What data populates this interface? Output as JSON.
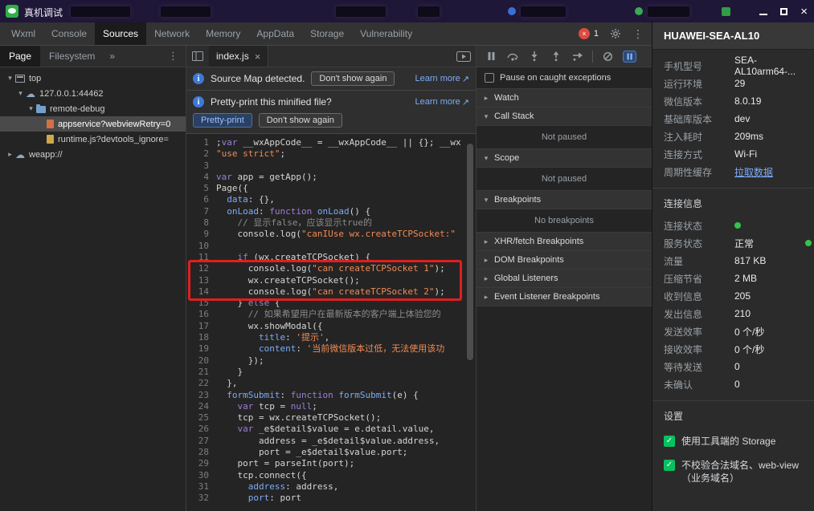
{
  "icons": {
    "close_x": "×",
    "error_x": "×",
    "kebab": "⋮",
    "overflow": "»",
    "external": "↗",
    "cloud": "☁",
    "check": "✓",
    "expanded": "▾",
    "collapsed": "▸",
    "info": "i"
  },
  "titlebar": {
    "title": "真机调试"
  },
  "devtools": {
    "tabs": [
      {
        "label": "Wxml",
        "active": false
      },
      {
        "label": "Console",
        "active": false
      },
      {
        "label": "Sources",
        "active": true
      },
      {
        "label": "Network",
        "active": false
      },
      {
        "label": "Memory",
        "active": false
      },
      {
        "label": "AppData",
        "active": false
      },
      {
        "label": "Storage",
        "active": false
      },
      {
        "label": "Vulnerability",
        "active": false
      }
    ],
    "error_count": "1"
  },
  "sources": {
    "sidebar": {
      "tabs": [
        {
          "label": "Page",
          "active": true
        },
        {
          "label": "Filesystem",
          "active": false
        }
      ],
      "tree": [
        {
          "depth": 0,
          "arrow": "expanded",
          "icon": "frame",
          "label": "top"
        },
        {
          "depth": 1,
          "arrow": "expanded",
          "icon": "cloud",
          "label": "127.0.0.1:44462"
        },
        {
          "depth": 2,
          "arrow": "expanded",
          "icon": "folder",
          "label": "remote-debug"
        },
        {
          "depth": 3,
          "arrow": "none",
          "icon": "file-orange",
          "label": "appservice?webviewRetry=0",
          "selected": true
        },
        {
          "depth": 3,
          "arrow": "none",
          "icon": "file-js",
          "label": "runtime.js?devtools_ignore="
        },
        {
          "depth": 0,
          "arrow": "collapsed",
          "icon": "cloud",
          "label": "weapp://"
        }
      ]
    },
    "editor": {
      "tab": "index.js",
      "infobars": [
        {
          "message": "Source Map detected.",
          "dismiss": "Don't show again",
          "link": "Learn more"
        },
        {
          "message": "Pretty-print this minified file?",
          "primary": "Pretty-print",
          "dismiss": "Don't show again",
          "link": "Learn more"
        }
      ],
      "code": {
        "lines": [
          {
            "n": 1,
            "s": [
              [
                "d",
                ";"
              ],
              [
                "k",
                "var"
              ],
              [
                "d",
                " __wxAppCode__ = __wxAppCode__ || {}; __wx"
              ]
            ]
          },
          {
            "n": 2,
            "s": [
              [
                "s",
                "\"use strict\""
              ],
              [
                "d",
                ";"
              ]
            ]
          },
          {
            "n": 3,
            "s": []
          },
          {
            "n": 4,
            "s": [
              [
                "k",
                "var"
              ],
              [
                "d",
                " app = getApp();"
              ]
            ]
          },
          {
            "n": 5,
            "s": [
              [
                "d",
                "Page({"
              ]
            ]
          },
          {
            "n": 6,
            "s": [
              [
                "d",
                "  "
              ],
              [
                "p",
                "data"
              ],
              [
                "d",
                ": {},"
              ]
            ]
          },
          {
            "n": 7,
            "s": [
              [
                "d",
                "  "
              ],
              [
                "p",
                "onLoad"
              ],
              [
                "d",
                ": "
              ],
              [
                "k",
                "function"
              ],
              [
                "d",
                " "
              ],
              [
                "p",
                "onLoad"
              ],
              [
                "d",
                "() {"
              ]
            ]
          },
          {
            "n": 8,
            "s": [
              [
                "d",
                "    "
              ],
              [
                "c",
                "// 显示false，应该显示true的"
              ]
            ]
          },
          {
            "n": 9,
            "s": [
              [
                "d",
                "    console.log("
              ],
              [
                "s",
                "\"canIUse wx.createTCPSocket:\""
              ]
            ]
          },
          {
            "n": 10,
            "s": []
          },
          {
            "n": 11,
            "s": [
              [
                "d",
                "    "
              ],
              [
                "k",
                "if"
              ],
              [
                "d",
                " (wx.createTCPSocket) {"
              ]
            ]
          },
          {
            "n": 12,
            "s": [
              [
                "d",
                "      console.log("
              ],
              [
                "s",
                "\"can createTCPSocket 1\""
              ],
              [
                "d",
                ");"
              ]
            ]
          },
          {
            "n": 13,
            "s": [
              [
                "d",
                "      wx.createTCPSocket();"
              ]
            ]
          },
          {
            "n": 14,
            "s": [
              [
                "d",
                "      console.log("
              ],
              [
                "s",
                "\"can createTCPSocket 2\""
              ],
              [
                "d",
                ");"
              ]
            ]
          },
          {
            "n": 15,
            "s": [
              [
                "d",
                "    } "
              ],
              [
                "k",
                "else"
              ],
              [
                "d",
                " {"
              ]
            ]
          },
          {
            "n": 16,
            "s": [
              [
                "d",
                "      "
              ],
              [
                "c",
                "// 如果希望用户在最新版本的客户端上体验您的"
              ]
            ]
          },
          {
            "n": 17,
            "s": [
              [
                "d",
                "      wx.showModal({"
              ]
            ]
          },
          {
            "n": 18,
            "s": [
              [
                "d",
                "        "
              ],
              [
                "p",
                "title"
              ],
              [
                "d",
                ": "
              ],
              [
                "s",
                "'提示'"
              ],
              [
                "d",
                ","
              ]
            ]
          },
          {
            "n": 19,
            "s": [
              [
                "d",
                "        "
              ],
              [
                "p",
                "content"
              ],
              [
                "d",
                ": "
              ],
              [
                "s",
                "'当前微信版本过低，无法使用该功"
              ]
            ]
          },
          {
            "n": 20,
            "s": [
              [
                "d",
                "      });"
              ]
            ]
          },
          {
            "n": 21,
            "s": [
              [
                "d",
                "    }"
              ]
            ]
          },
          {
            "n": 22,
            "s": [
              [
                "d",
                "  },"
              ]
            ]
          },
          {
            "n": 23,
            "s": [
              [
                "d",
                "  "
              ],
              [
                "p",
                "formSubmit"
              ],
              [
                "d",
                ": "
              ],
              [
                "k",
                "function"
              ],
              [
                "d",
                " "
              ],
              [
                "p",
                "formSubmit"
              ],
              [
                "d",
                "(e) {"
              ]
            ]
          },
          {
            "n": 24,
            "s": [
              [
                "d",
                "    "
              ],
              [
                "k",
                "var"
              ],
              [
                "d",
                " tcp = "
              ],
              [
                "k",
                "null"
              ],
              [
                "d",
                ";"
              ]
            ]
          },
          {
            "n": 25,
            "s": [
              [
                "d",
                "    tcp = wx.createTCPSocket();"
              ]
            ]
          },
          {
            "n": 26,
            "s": [
              [
                "d",
                "    "
              ],
              [
                "k",
                "var"
              ],
              [
                "d",
                " _e$detail$value = e.detail.value,"
              ]
            ]
          },
          {
            "n": 27,
            "s": [
              [
                "d",
                "        address = _e$detail$value.address,"
              ]
            ]
          },
          {
            "n": 28,
            "s": [
              [
                "d",
                "        port = _e$detail$value.port;"
              ]
            ]
          },
          {
            "n": 29,
            "s": [
              [
                "d",
                "    port = parseInt(port);"
              ]
            ]
          },
          {
            "n": 30,
            "s": [
              [
                "d",
                "    tcp.connect({"
              ]
            ]
          },
          {
            "n": 31,
            "s": [
              [
                "d",
                "      "
              ],
              [
                "p",
                "address"
              ],
              [
                "d",
                ": address,"
              ]
            ]
          },
          {
            "n": 32,
            "s": [
              [
                "d",
                "      "
              ],
              [
                "p",
                "port"
              ],
              [
                "d",
                ": port"
              ]
            ]
          }
        ]
      }
    }
  },
  "debugger": {
    "toolbar_icons": [
      "pause",
      "step-over",
      "step-into",
      "step-out",
      "step",
      "deactivate-breakpoints",
      "pause-on-exceptions"
    ],
    "pause_on_caught": {
      "label": "Pause on caught exceptions",
      "checked": false
    },
    "sections": [
      {
        "label": "Watch",
        "state": "collapsed"
      },
      {
        "label": "Call Stack",
        "state": "expanded",
        "body": "Not paused"
      },
      {
        "label": "Scope",
        "state": "expanded",
        "body": "Not paused"
      },
      {
        "label": "Breakpoints",
        "state": "expanded",
        "body": "No breakpoints"
      },
      {
        "label": "XHR/fetch Breakpoints",
        "state": "collapsed"
      },
      {
        "label": "DOM Breakpoints",
        "state": "collapsed"
      },
      {
        "label": "Global Listeners",
        "state": "collapsed"
      },
      {
        "label": "Event Listener Breakpoints",
        "state": "collapsed"
      }
    ]
  },
  "device_panel": {
    "title": "HUAWEI-SEA-AL10",
    "info_rows": [
      {
        "label": "手机型号",
        "value": "SEA-AL10arm64-..."
      },
      {
        "label": "运行环境",
        "value": "29"
      },
      {
        "label": "微信版本",
        "value": "8.0.19"
      },
      {
        "label": "基础库版本",
        "value": "dev"
      },
      {
        "label": "注入耗时",
        "value": "209ms"
      },
      {
        "label": "连接方式",
        "value": "Wi-Fi"
      },
      {
        "label": "周期性缓存",
        "value": "拉取数据",
        "link": true
      }
    ],
    "connection_section": {
      "title": "连接信息",
      "rows": [
        {
          "label": "连接状态",
          "value": "",
          "dot": true
        },
        {
          "label": "服务状态",
          "value": "正常",
          "edge_dot": true
        },
        {
          "label": "流量",
          "value": "817 KB"
        },
        {
          "label": "压缩节省",
          "value": "2 MB"
        },
        {
          "label": "收到信息",
          "value": "205"
        },
        {
          "label": "发出信息",
          "value": "210"
        },
        {
          "label": "发送效率",
          "value": "0 个/秒"
        },
        {
          "label": "接收效率",
          "value": "0 个/秒"
        },
        {
          "label": "等待发送",
          "value": "0"
        },
        {
          "label": "未确认",
          "value": "0"
        }
      ]
    },
    "settings_section": {
      "title": "设置",
      "options": [
        {
          "label": "使用工具端的 Storage",
          "checked": true
        },
        {
          "label": "不校验合法域名、web-view（业务域名）",
          "checked": true
        }
      ]
    }
  }
}
